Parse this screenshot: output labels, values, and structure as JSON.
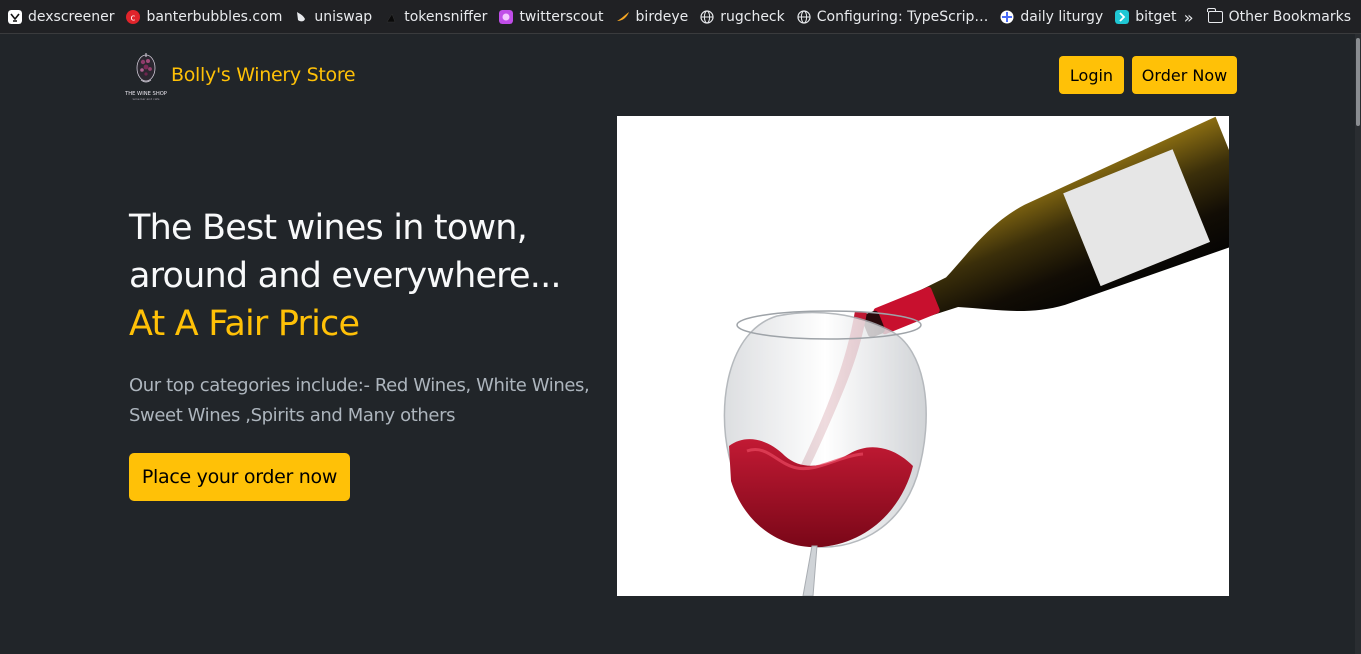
{
  "bookmarks": [
    {
      "label": "dexscreener",
      "icon": "dexscreener-icon",
      "color": "#ffffff"
    },
    {
      "label": "banterbubbles.com",
      "icon": "banterbubbles-icon",
      "color": "#e0242b"
    },
    {
      "label": "uniswap",
      "icon": "uniswap-icon",
      "color": "#ffffff"
    },
    {
      "label": "tokensniffer",
      "icon": "tokensniffer-icon",
      "color": "#111111"
    },
    {
      "label": "twitterscout",
      "icon": "twitterscout-icon",
      "color": "#c04de8"
    },
    {
      "label": "birdeye",
      "icon": "birdeye-icon",
      "color": "#f5a623"
    },
    {
      "label": "rugcheck",
      "icon": "globe-icon",
      "color": "#e8eaed"
    },
    {
      "label": "Configuring: TypeScrip…",
      "icon": "globe-icon",
      "color": "#e8eaed"
    },
    {
      "label": "daily liturgy",
      "icon": "liturgy-icon",
      "color": "#4a6cf7"
    },
    {
      "label": "bitget",
      "icon": "bitget-icon",
      "color": "#1fc7d4"
    }
  ],
  "other_bookmarks": "Other Bookmarks",
  "nav": {
    "brand": "Bolly's Winery Store",
    "logo_text": "THE WINE SHOP",
    "logo_subtext": "wine bar and cafe",
    "login": "Login",
    "order_now": "Order Now"
  },
  "hero": {
    "heading_line1": "The Best wines in town,",
    "heading_line2": "around and everywhere...",
    "heading_accent": "At A Fair Price",
    "description": "Our top categories include:- Red Wines, White Wines, Sweet Wines ,Spirits and Many others",
    "cta": "Place your order now"
  },
  "colors": {
    "background": "#212529",
    "accent": "#ffc107",
    "muted_text": "#adb5bd"
  }
}
